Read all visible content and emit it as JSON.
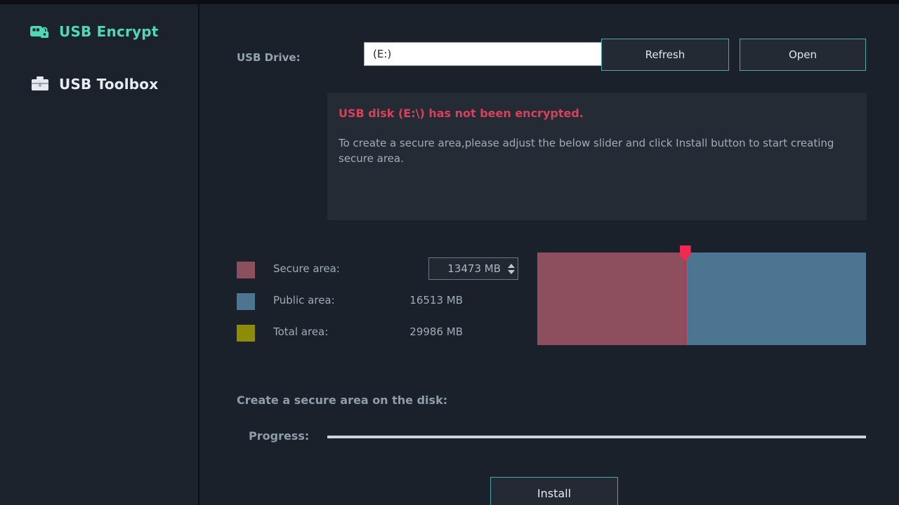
{
  "window": {
    "title_strip": ""
  },
  "sidebar": {
    "items": [
      {
        "label": "USB Encrypt",
        "icon": "usb-lock-icon",
        "color": "#4ed8b4",
        "active": true
      },
      {
        "label": "USB Toolbox",
        "icon": "toolbox-icon",
        "color": "#e7ecf1",
        "active": false
      }
    ]
  },
  "drive_row": {
    "label": "USB Drive:",
    "select": {
      "value": "(E:)",
      "icon": "chevron-down-icon"
    },
    "refresh_label": "Refresh",
    "open_label": "Open"
  },
  "message": {
    "title": "USB disk (E:\\) has not been encrypted.",
    "body": "To create a secure area,please adjust the below slider and click Install button to start creating secure area."
  },
  "areas": {
    "secure": {
      "label": "Secure area:",
      "value": "13473 MB",
      "color": "#8d4f5d"
    },
    "public": {
      "label": "Public area:",
      "value": "16513 MB",
      "color": "#4b7590"
    },
    "total": {
      "label": "Total area:",
      "value": "29986 MB",
      "color": "#8c8c09"
    },
    "secure_percent": 45,
    "slider_handle_color": "#ef2a4e"
  },
  "create": {
    "title": "Create a secure area on the disk:",
    "progress_label": "Progress:",
    "progress_percent": 0,
    "install_label": "Install"
  }
}
